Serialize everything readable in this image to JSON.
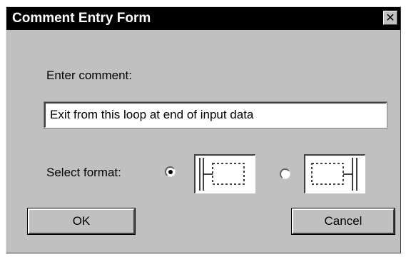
{
  "window": {
    "title": "Comment Entry Form",
    "close_glyph": "✕",
    "close_icon": "close-icon"
  },
  "comment": {
    "label": "Enter comment:",
    "value": "Exit from this loop at end of input data"
  },
  "format": {
    "label": "Select format:",
    "options": [
      {
        "id": "left-bracket",
        "selected": true,
        "icon": "left-bracket-format-icon"
      },
      {
        "id": "right-bracket",
        "selected": false,
        "icon": "right-bracket-format-icon"
      }
    ]
  },
  "buttons": {
    "ok_label": "OK",
    "cancel_label": "Cancel"
  },
  "colors": {
    "dialog_background": "#c0c0c0",
    "titlebar_background": "#000000",
    "title_text": "#ffffff"
  }
}
